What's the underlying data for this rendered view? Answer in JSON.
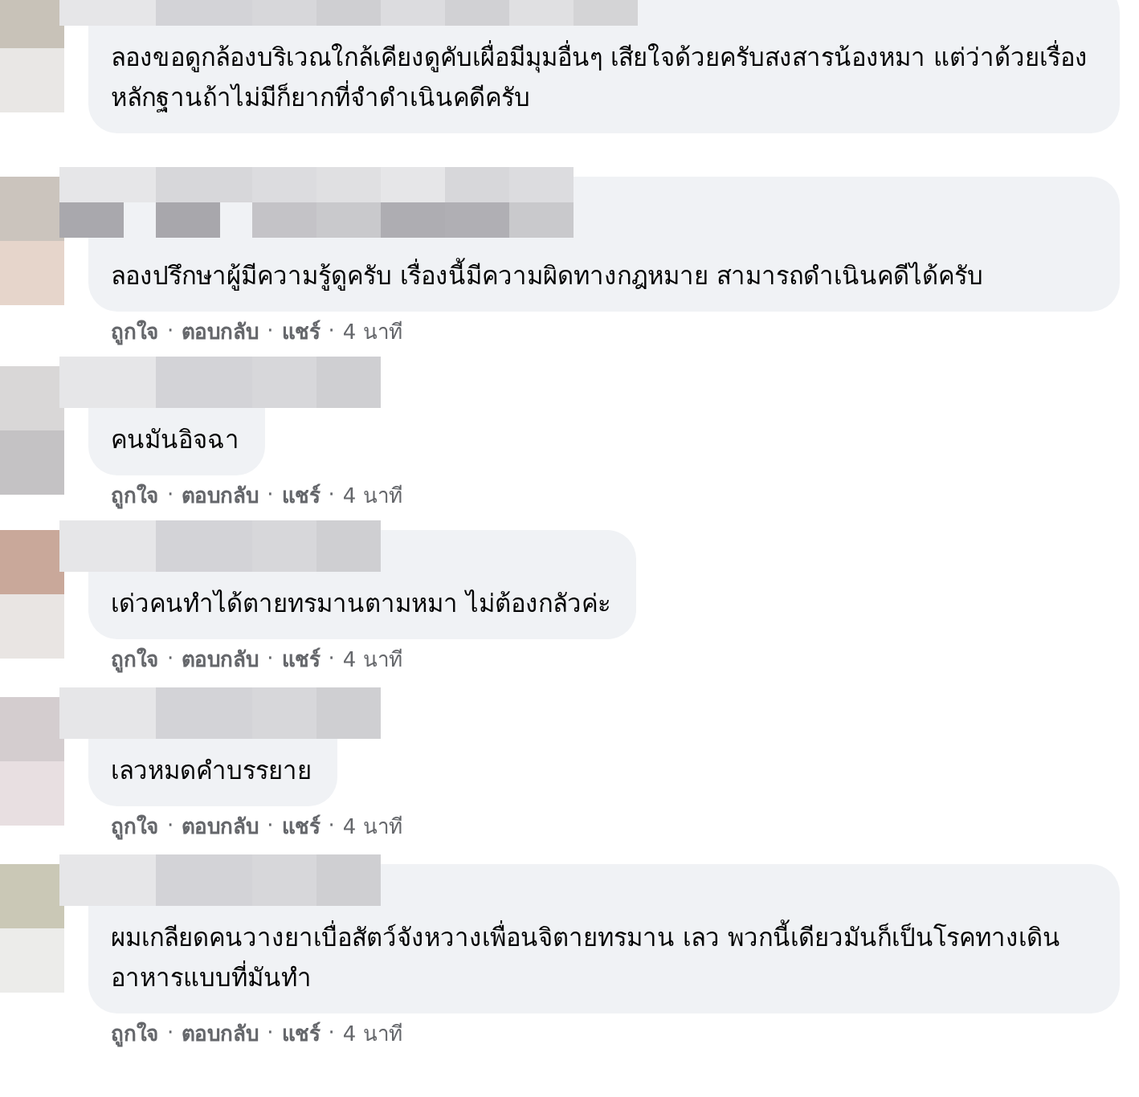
{
  "comments": [
    {
      "text": "ลองขอดูกล้องบริเวณใกล้เคียงดูคับเผื่อมีมุมอื่นๆ เสียใจด้วยครับสงสารน้องหมา แต่ว่าด้วยเรื่องหลักฐานถ้าไม่มีก็ยากที่จำดำเนินคดีครับ"
    },
    {
      "text": "ลองปรึกษาผู้มีความรู้ดูครับ เรื่องนี้มีความผิดทางกฎหมาย สามารถดำเนินคดีได้ครับ",
      "actions": [
        {
          "kind": "link",
          "text": "ถูกใจ"
        },
        {
          "kind": "dot",
          "text": "·"
        },
        {
          "kind": "link",
          "text": "ตอบกลับ"
        },
        {
          "kind": "dot",
          "text": "·"
        },
        {
          "kind": "link",
          "text": "แชร์"
        },
        {
          "kind": "dot",
          "text": "·"
        },
        {
          "kind": "time",
          "text": "4 นาที"
        }
      ]
    },
    {
      "text": "คนมันอิจฉา",
      "actions": [
        {
          "kind": "link",
          "text": "ถูกใจ"
        },
        {
          "kind": "dot",
          "text": "·"
        },
        {
          "kind": "link",
          "text": "ตอบกลับ"
        },
        {
          "kind": "dot",
          "text": "·"
        },
        {
          "kind": "link",
          "text": "แชร์"
        },
        {
          "kind": "dot",
          "text": "·"
        },
        {
          "kind": "time",
          "text": "4 นาที"
        }
      ]
    },
    {
      "text": "เด่วคนทำได้ตายทรมานตามหมา ไม่ต้องกลัวค่ะ",
      "actions": [
        {
          "kind": "link",
          "text": "ถูกใจ"
        },
        {
          "kind": "dot",
          "text": "·"
        },
        {
          "kind": "link",
          "text": "ตอบกลับ"
        },
        {
          "kind": "dot",
          "text": "·"
        },
        {
          "kind": "link",
          "text": "แชร์"
        },
        {
          "kind": "dot",
          "text": "·"
        },
        {
          "kind": "time",
          "text": "4 นาที"
        }
      ]
    },
    {
      "text": "เลวหมดคำบรรยาย",
      "actions": [
        {
          "kind": "link",
          "text": "ถูกใจ"
        },
        {
          "kind": "dot",
          "text": "·"
        },
        {
          "kind": "link",
          "text": "ตอบกลับ"
        },
        {
          "kind": "dot",
          "text": "·"
        },
        {
          "kind": "link",
          "text": "แชร์"
        },
        {
          "kind": "dot",
          "text": "·"
        },
        {
          "kind": "time",
          "text": "4 นาที"
        }
      ]
    },
    {
      "text": "ผมเกลียดคนวางยาเบื่อสัตว์จังหวางเพื่อนจิตายทรมาน เลว พวกนี้เดียวมันก็เป็นโรคทางเดินอาหารแบบที่มันทำ",
      "actions": [
        {
          "kind": "link",
          "text": "ถูกใจ"
        },
        {
          "kind": "dot",
          "text": "·"
        },
        {
          "kind": "link",
          "text": "ตอบกลับ"
        },
        {
          "kind": "dot",
          "text": "·"
        },
        {
          "kind": "link",
          "text": "แชร์"
        },
        {
          "kind": "dot",
          "text": "·"
        },
        {
          "kind": "time",
          "text": "4 นาที"
        }
      ]
    }
  ]
}
